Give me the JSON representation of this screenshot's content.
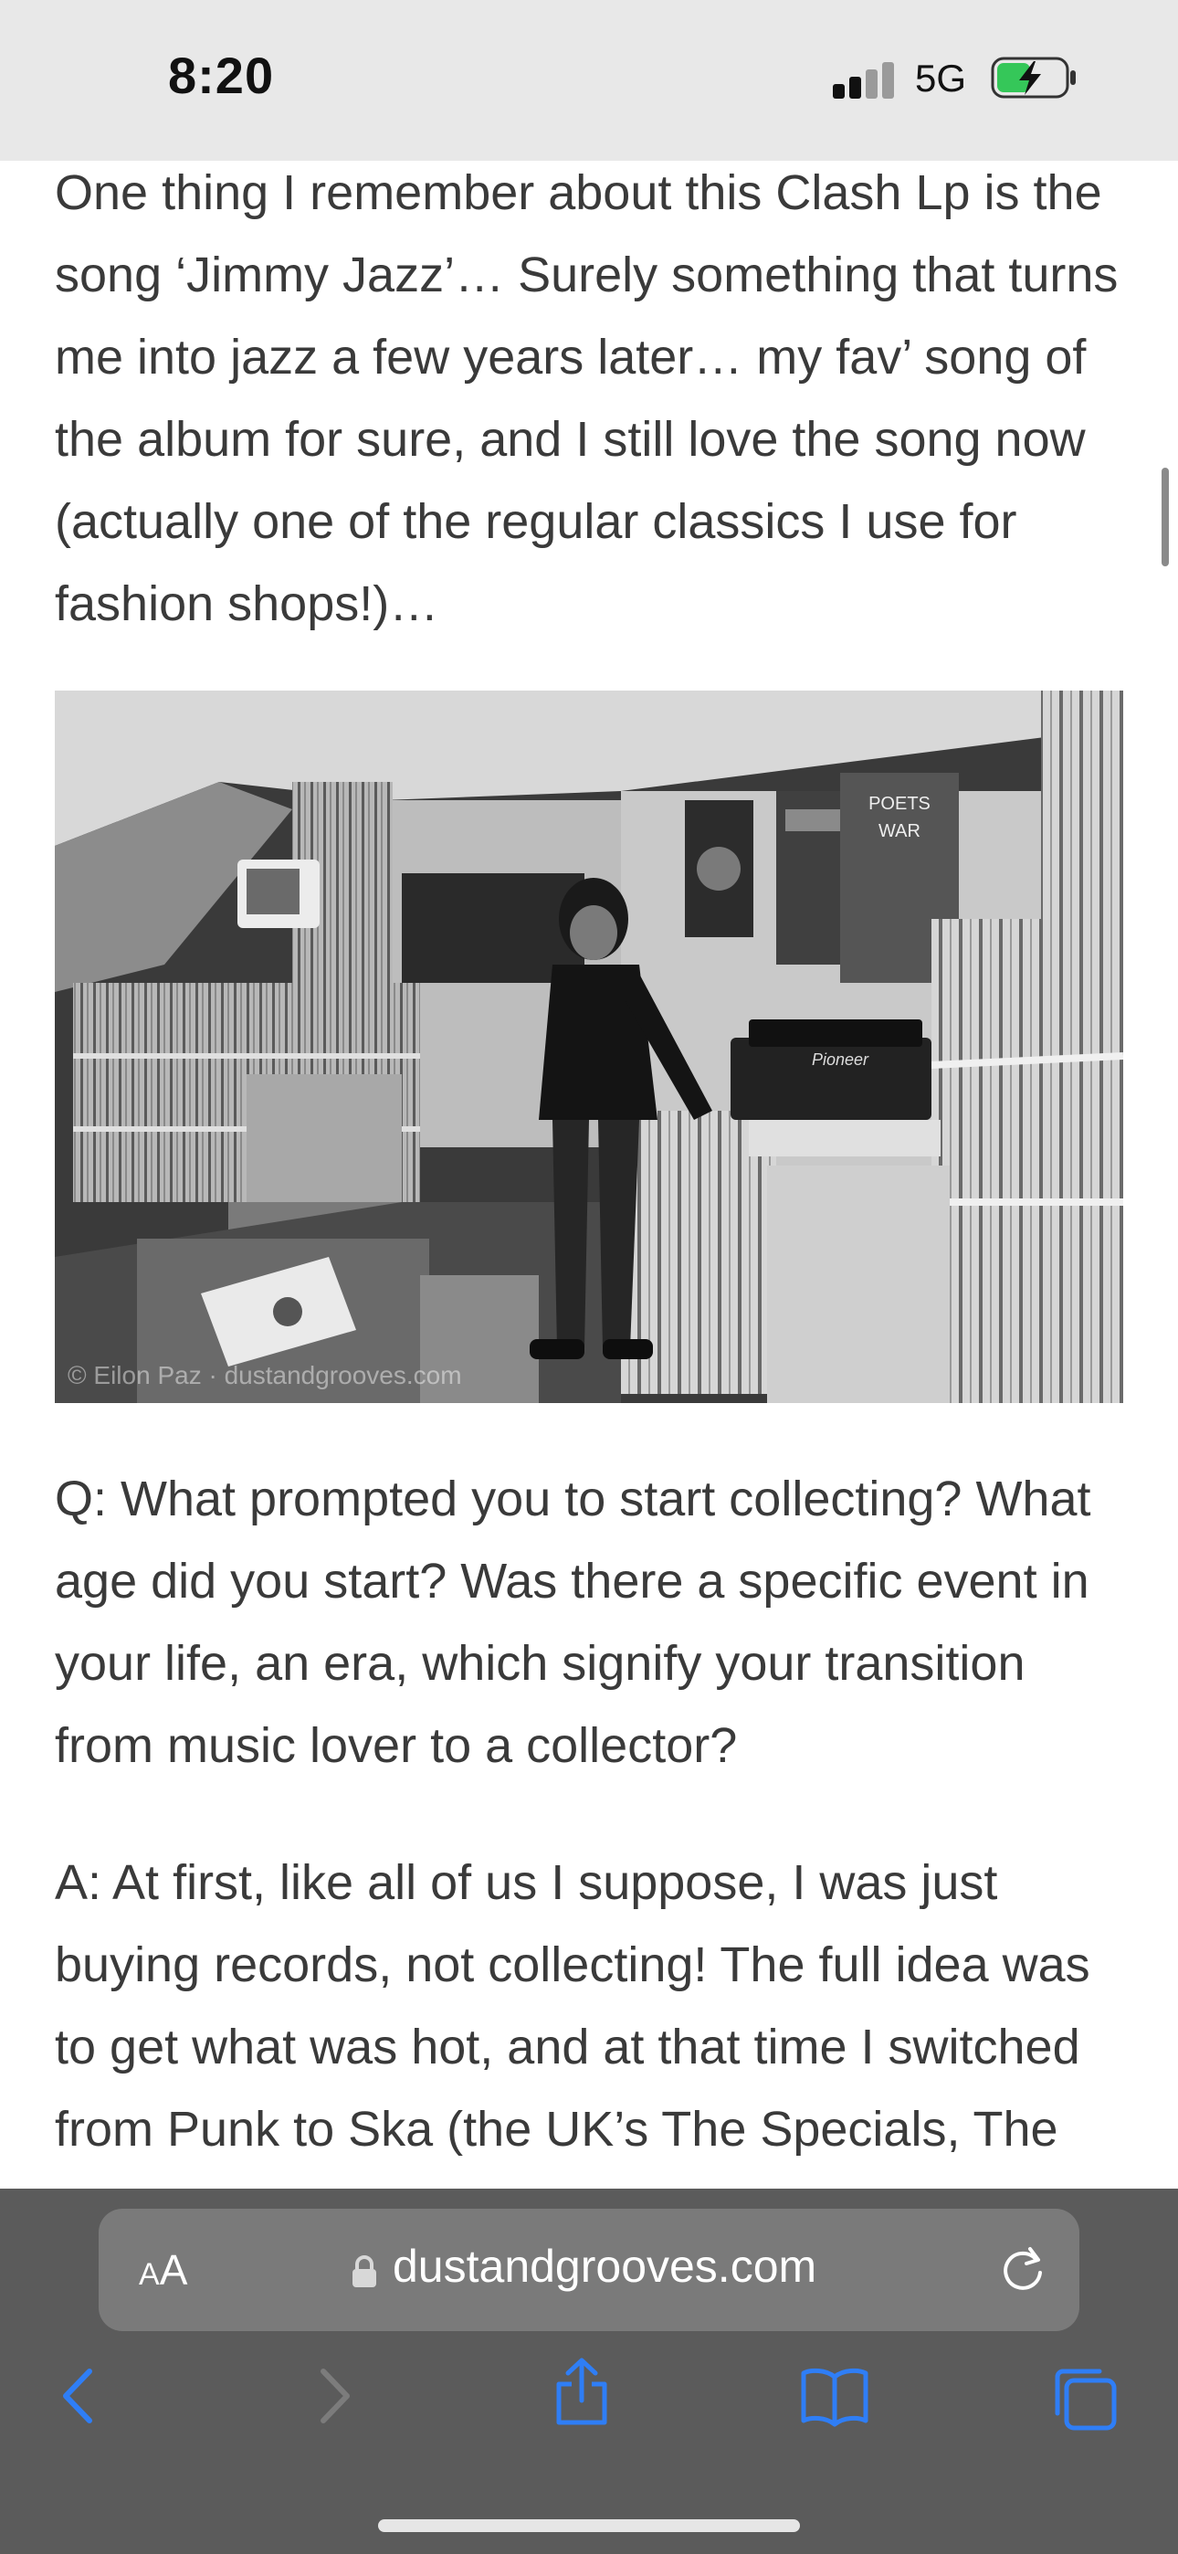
{
  "status_bar": {
    "time": "8:20",
    "network": "5G",
    "battery_state": "charging",
    "signal_bars_active": 2,
    "signal_bars_total": 4
  },
  "article": {
    "paragraphs": [
      "One thing I remember about this Clash Lp is the song ‘Jimmy Jazz’… Surely something that turns me into jazz a few years later… my fav’ song of the album for sure, and I still love the song now (actually one of the regular classics I use for fashion shops!)…",
      "Q: What prompted you to start collecting? What age did you start? Was there a specific event in your life, an era, which signify your transition from music lover to a collector?",
      "A: At first, like all of us I suppose, I was just buying records, not collecting! The full idea was to get what was hot, and at that time I switched from Punk to Ska (the UK’s The Specials, The Selector,"
    ],
    "photo": {
      "watermark": "© Eilon Paz · dustandgrooves.com",
      "turntable_brand": "Pioneer",
      "poster_text_1": "POETS",
      "poster_text_2": "WAR"
    }
  },
  "browser": {
    "text_size_label_small": "A",
    "text_size_label_large": "A",
    "url": "dustandgrooves.com",
    "icons": [
      "lock-icon",
      "reload-icon",
      "back-icon",
      "forward-icon",
      "share-icon",
      "bookmarks-icon",
      "tabs-icon"
    ]
  },
  "colors": {
    "status_bar_bg": "#e8e8e8",
    "toolbar_bg": "#5b5b5b",
    "urlbar_bg": "#7a7a7a",
    "link_blue": "#2f7ef6",
    "battery_green": "#35c759",
    "body_text": "#3a3a3a"
  }
}
